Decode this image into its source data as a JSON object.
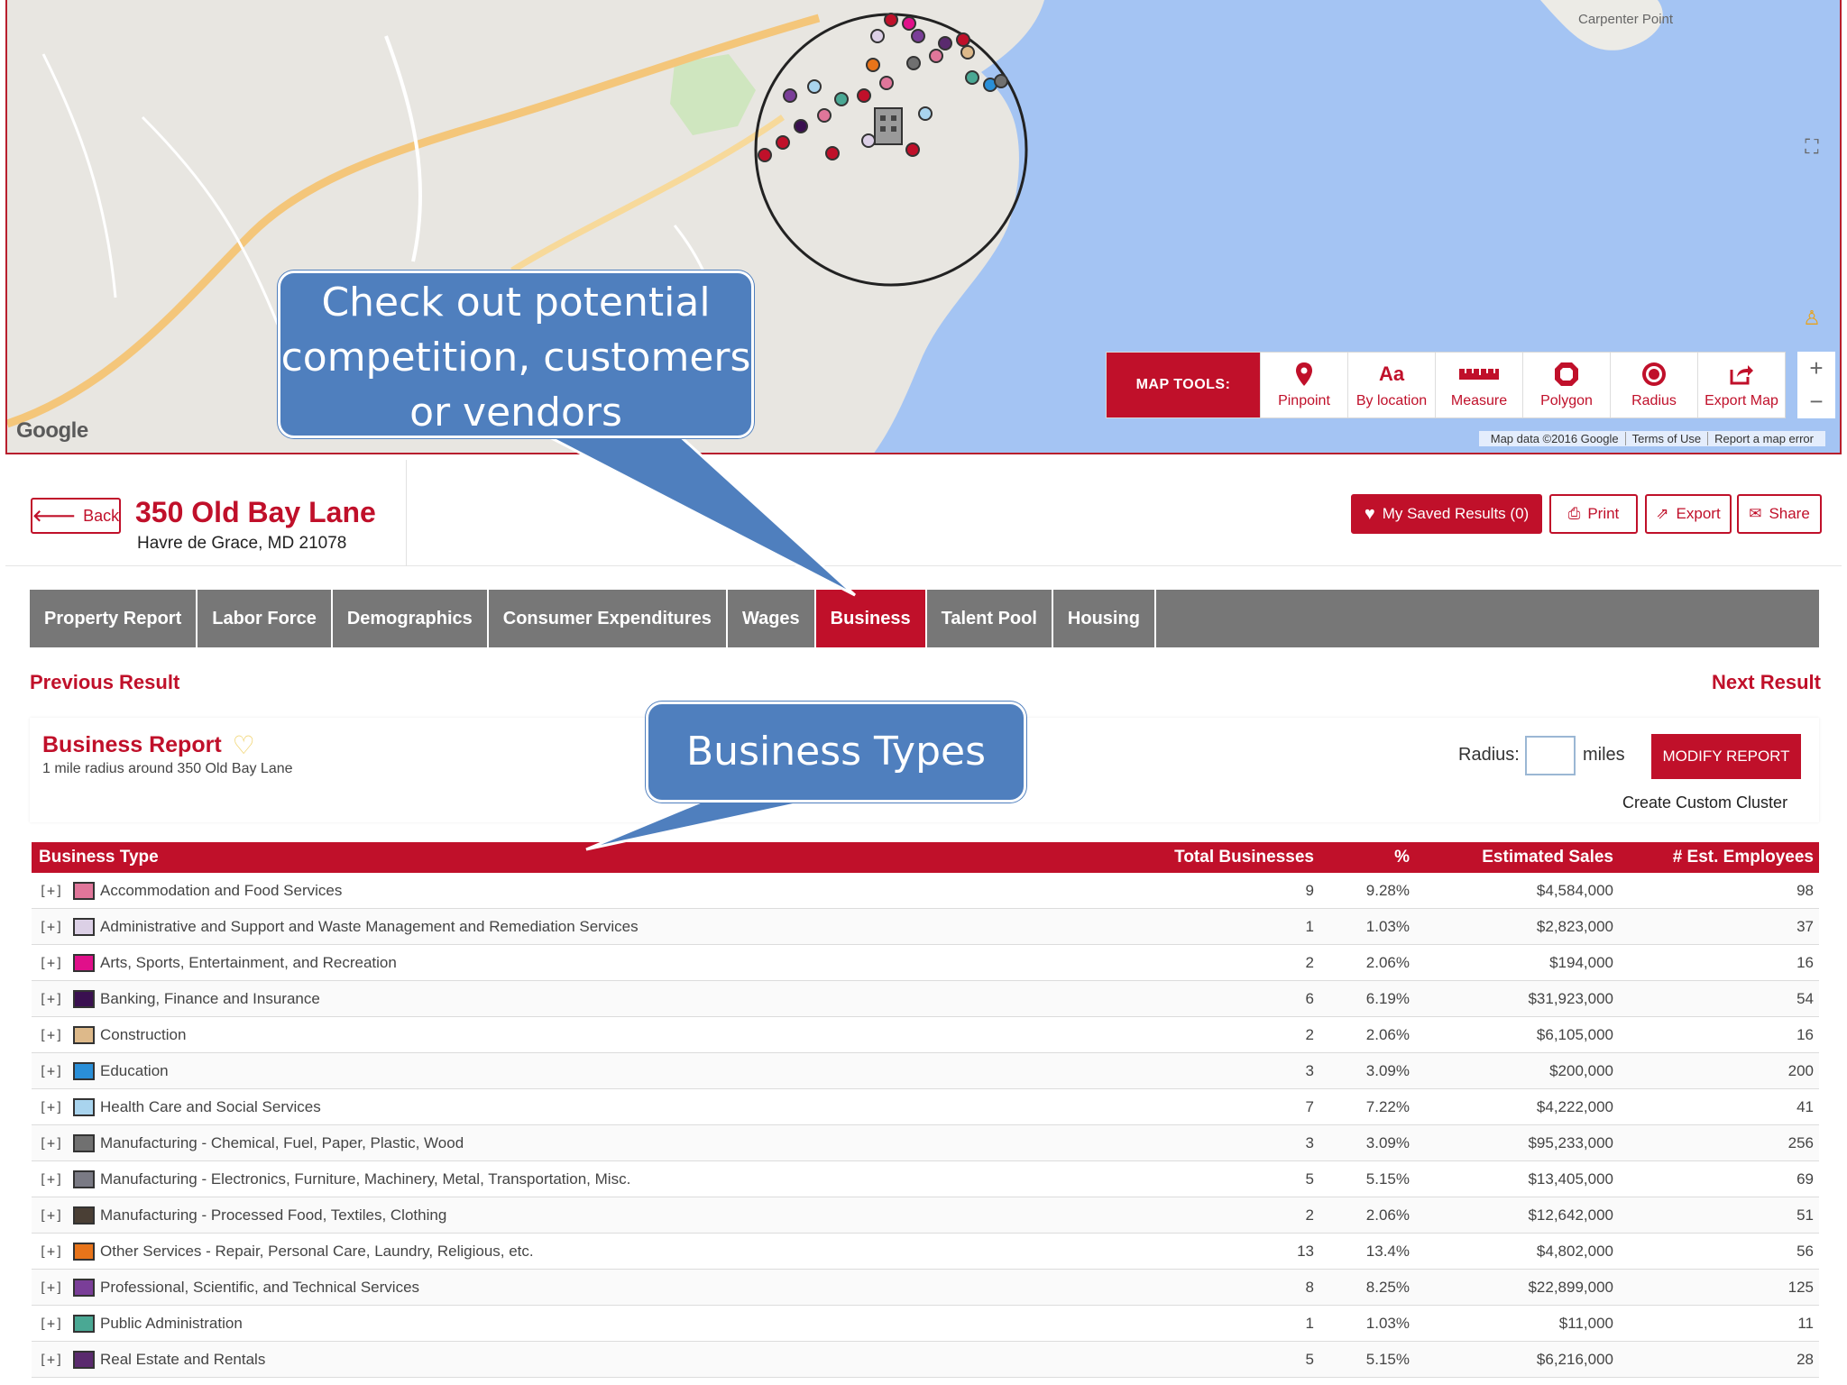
{
  "map": {
    "place_label": "Carpenter Point",
    "google_label": "Google",
    "attribution": [
      "Map data ©2016 Google",
      "Terms of Use",
      "Report a map error"
    ],
    "tools_label": "MAP TOOLS:",
    "tools": [
      {
        "label": "Pinpoint",
        "icon": "pin-icon"
      },
      {
        "label": "By location",
        "icon": "text-aa-icon",
        "glyph": "Aa"
      },
      {
        "label": "Measure",
        "icon": "ruler-icon"
      },
      {
        "label": "Polygon",
        "icon": "polygon-icon"
      },
      {
        "label": "Radius",
        "icon": "radius-icon"
      },
      {
        "label": "Export Map",
        "icon": "export-icon"
      }
    ],
    "zoom_in": "+",
    "zoom_out": "−"
  },
  "header": {
    "back_label": "Back",
    "address": "350 Old Bay Lane",
    "city_line": "Havre de Grace, MD 21078",
    "saved_label": "My Saved Results (0)",
    "print_label": "Print",
    "export_label": "Export",
    "share_label": "Share"
  },
  "tabs": [
    {
      "label": "Property Report",
      "active": false
    },
    {
      "label": "Labor Force",
      "active": false
    },
    {
      "label": "Demographics",
      "active": false
    },
    {
      "label": "Consumer Expenditures",
      "active": false
    },
    {
      "label": "Wages",
      "active": false
    },
    {
      "label": "Business",
      "active": true
    },
    {
      "label": "Talent Pool",
      "active": false
    },
    {
      "label": "Housing",
      "active": false
    }
  ],
  "nav": {
    "previous": "Previous Result",
    "next": "Next Result"
  },
  "report": {
    "title": "Business Report",
    "subtitle": "1 mile radius around 350 Old Bay Lane",
    "radius_label": "Radius:",
    "radius_value": "",
    "miles_label": "miles",
    "modify_label": "MODIFY REPORT",
    "cluster_label": "Create Custom Cluster"
  },
  "table": {
    "headers": [
      "Business Type",
      "Total Businesses",
      "%",
      "Estimated Sales",
      "# Est. Employees"
    ],
    "expander": "[+]",
    "rows": [
      {
        "type": "Accommodation and Food Services",
        "color": "#e0769a",
        "total": "9",
        "pct": "9.28%",
        "sales": "$4,584,000",
        "emp": "98"
      },
      {
        "type": "Administrative and Support and Waste Management and Remediation Services",
        "color": "#dcd0e6",
        "total": "1",
        "pct": "1.03%",
        "sales": "$2,823,000",
        "emp": "37"
      },
      {
        "type": "Arts, Sports, Entertainment, and Recreation",
        "color": "#e0108a",
        "total": "2",
        "pct": "2.06%",
        "sales": "$194,000",
        "emp": "16"
      },
      {
        "type": "Banking, Finance and Insurance",
        "color": "#3a1050",
        "total": "6",
        "pct": "6.19%",
        "sales": "$31,923,000",
        "emp": "54"
      },
      {
        "type": "Construction",
        "color": "#ddb98a",
        "total": "2",
        "pct": "2.06%",
        "sales": "$6,105,000",
        "emp": "16"
      },
      {
        "type": "Education",
        "color": "#2a8fd8",
        "total": "3",
        "pct": "3.09%",
        "sales": "$200,000",
        "emp": "200"
      },
      {
        "type": "Health Care and Social Services",
        "color": "#a9d4ee",
        "total": "7",
        "pct": "7.22%",
        "sales": "$4,222,000",
        "emp": "41"
      },
      {
        "type": "Manufacturing - Chemical, Fuel, Paper, Plastic, Wood",
        "color": "#707070",
        "total": "3",
        "pct": "3.09%",
        "sales": "$95,233,000",
        "emp": "256"
      },
      {
        "type": "Manufacturing - Electronics, Furniture, Machinery, Metal, Transportation, Misc.",
        "color": "#7a7a84",
        "total": "5",
        "pct": "5.15%",
        "sales": "$13,405,000",
        "emp": "69"
      },
      {
        "type": "Manufacturing - Processed Food, Textiles, Clothing",
        "color": "#4a3f35",
        "total": "2",
        "pct": "2.06%",
        "sales": "$12,642,000",
        "emp": "51"
      },
      {
        "type": "Other Services - Repair, Personal Care, Laundry, Religious, etc.",
        "color": "#e8741a",
        "total": "13",
        "pct": "13.4%",
        "sales": "$4,802,000",
        "emp": "56"
      },
      {
        "type": "Professional, Scientific, and Technical Services",
        "color": "#7a3e98",
        "total": "8",
        "pct": "8.25%",
        "sales": "$22,899,000",
        "emp": "125"
      },
      {
        "type": "Public Administration",
        "color": "#4aa894",
        "total": "1",
        "pct": "1.03%",
        "sales": "$11,000",
        "emp": "11"
      },
      {
        "type": "Real Estate and Rentals",
        "color": "#5a2a6e",
        "total": "5",
        "pct": "5.15%",
        "sales": "$6,216,000",
        "emp": "28"
      }
    ]
  },
  "callouts": {
    "competition": "Check out potential competition, customers or vendors",
    "business_types": "Business Types"
  },
  "colors": {
    "brand_red": "#c0102a",
    "tab_gray": "#777777",
    "callout_blue": "#4f7fbe",
    "water": "#a4c4f3"
  }
}
